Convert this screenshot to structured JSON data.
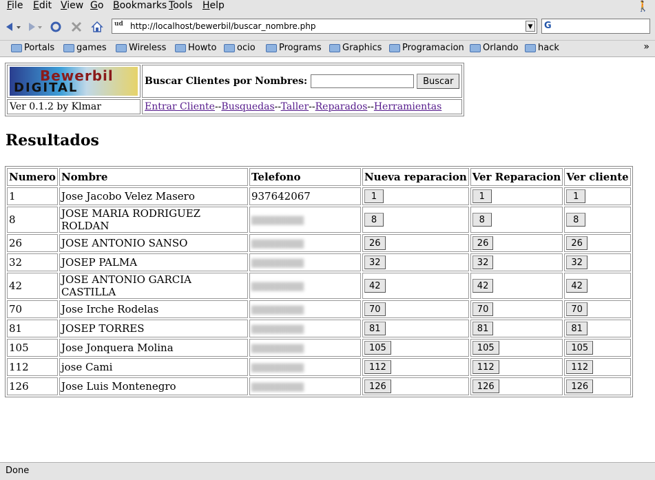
{
  "menu": [
    "File",
    "Edit",
    "View",
    "Go",
    "Bookmarks",
    "Tools",
    "Help"
  ],
  "nav": {
    "url": "http://localhost/bewerbil/buscar_nombre.php",
    "favicon": "ud"
  },
  "bookmarks": [
    "Portals",
    "games",
    "Wireless",
    "Howto",
    "ocio",
    "Programs",
    "Graphics",
    "Programacion",
    "Orlando",
    "hack"
  ],
  "header": {
    "logo_line1": "Bewerbil",
    "logo_line2": "DIGITAL",
    "search_label": "Buscar Clientes por Nombres:",
    "search_value": "",
    "search_button": "Buscar",
    "version": "Ver 0.1.2 by Klmar",
    "links": [
      "Entrar Cliente",
      "Busquedas",
      "Taller",
      "Reparados",
      "Herramientas"
    ],
    "separator": "--"
  },
  "results": {
    "title": "Resultados",
    "columns": [
      "Numero",
      "Nombre",
      "Telefono",
      "Nueva reparacion",
      "Ver Reparacion",
      "Ver cliente"
    ],
    "rows": [
      {
        "num": "1",
        "name": "Jose Jacobo Velez Masero",
        "phone": "937642067",
        "blurred": false
      },
      {
        "num": "8",
        "name": "JOSE MARIA RODRIGUEZ ROLDAN",
        "phone": "",
        "blurred": true
      },
      {
        "num": "26",
        "name": "JOSE ANTONIO SANSO",
        "phone": "",
        "blurred": true
      },
      {
        "num": "32",
        "name": "JOSEP PALMA",
        "phone": "",
        "blurred": true
      },
      {
        "num": "42",
        "name": "JOSE ANTONIO GARCIA CASTILLA",
        "phone": "",
        "blurred": true
      },
      {
        "num": "70",
        "name": "Jose Irche Rodelas",
        "phone": "",
        "blurred": true
      },
      {
        "num": "81",
        "name": "JOSEP TORRES",
        "phone": "",
        "blurred": true
      },
      {
        "num": "105",
        "name": "Jose Jonquera Molina",
        "phone": "",
        "blurred": true
      },
      {
        "num": "112",
        "name": "jose Cami",
        "phone": "",
        "blurred": true
      },
      {
        "num": "126",
        "name": "Jose Luis Montenegro",
        "phone": "",
        "blurred": true
      }
    ]
  },
  "status": "Done"
}
